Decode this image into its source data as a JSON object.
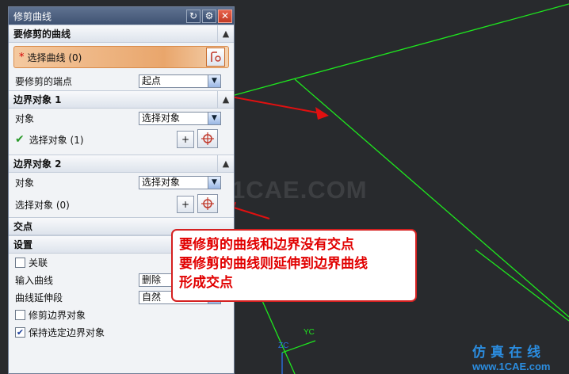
{
  "dialog": {
    "title": "修剪曲线",
    "sections": {
      "curve_to_trim": {
        "header": "要修剪的曲线",
        "select_curve_label": "选择曲线 (0)",
        "endpoint_label": "要修剪的端点",
        "endpoint_value": "起点"
      },
      "boundary1": {
        "header": "边界对象 1",
        "object_label": "对象",
        "object_value": "选择对象",
        "select_label": "选择对象 (1)"
      },
      "boundary2": {
        "header": "边界对象 2",
        "object_label": "对象",
        "object_value": "选择对象",
        "select_label": "选择对象 (0)"
      },
      "intersection": {
        "header": "交点"
      },
      "settings": {
        "header": "设置",
        "associative_label": "关联",
        "input_curve_label": "输入曲线",
        "input_curve_value": "删除",
        "extension_label": "曲线延伸段",
        "extension_value": "自然",
        "trim_boundary_label": "修剪边界对象",
        "keep_boundary_label": "保持选定边界对象"
      }
    }
  },
  "annotation": {
    "line1": "要修剪的曲线和边界没有交点",
    "line2": "要修剪的曲线则延伸到边界曲线",
    "line3": "形成交点"
  },
  "viewport": {
    "watermark": "1CAE.COM",
    "axis_zc": "ZC",
    "axis_yc": "YC"
  },
  "logo": {
    "text": "仿真在线",
    "url": "www.1CAE.com"
  },
  "colors": {
    "arrow": "#e01010",
    "curve": "#1ee81e",
    "axis": "#2a6fe0"
  }
}
